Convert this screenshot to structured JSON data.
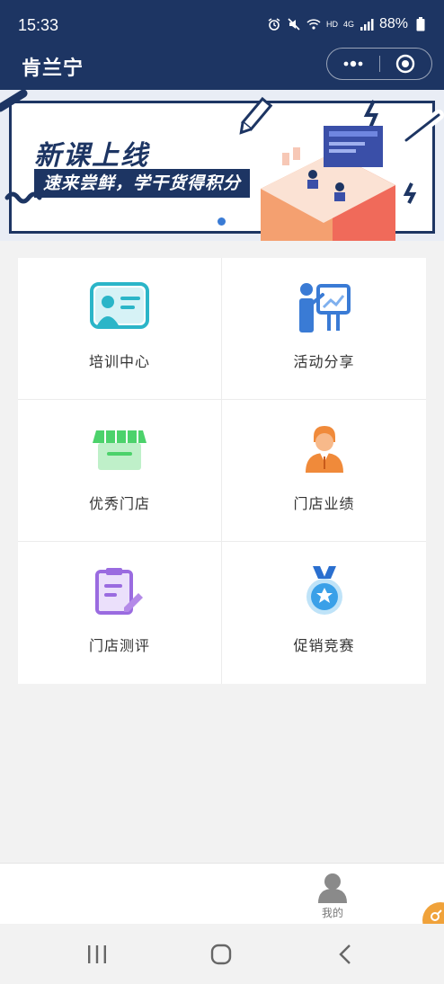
{
  "status": {
    "time": "15:33",
    "battery": "88%",
    "net_label": "HD",
    "signal_label": "4G"
  },
  "header": {
    "brand": "肯兰宁"
  },
  "banner": {
    "title": "新课上线",
    "subtitle": "速来尝鲜，学干货得积分",
    "accent": "#1d3563"
  },
  "menu": [
    {
      "label": "培训中心",
      "icon": "training-board-icon",
      "color": "#2bb5c8"
    },
    {
      "label": "活动分享",
      "icon": "presentation-icon",
      "color": "#3a7bd5"
    },
    {
      "label": "优秀门店",
      "icon": "storefront-icon",
      "color": "#4cd26b"
    },
    {
      "label": "门店业绩",
      "icon": "manager-avatar-icon",
      "color": "#f08a3a"
    },
    {
      "label": "门店测评",
      "icon": "clipboard-edit-icon",
      "color": "#9a6be0"
    },
    {
      "label": "促销竞赛",
      "icon": "medal-icon",
      "color": "#3aa0e8"
    }
  ],
  "tabbar": {
    "me_label": "我的"
  }
}
